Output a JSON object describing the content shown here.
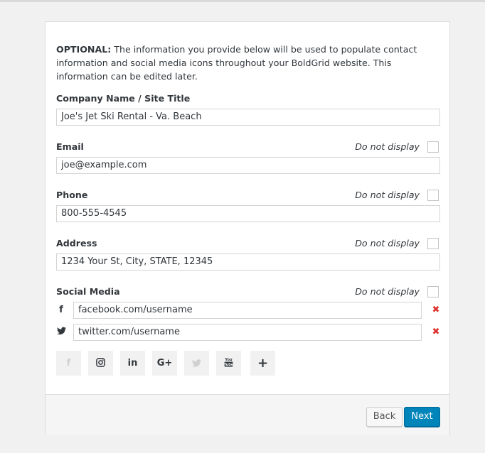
{
  "intro": {
    "prefix": "OPTIONAL:",
    "text": " The information you provide below will be used to populate contact information and social media icons throughout your BoldGrid website. This information can be edited later."
  },
  "company": {
    "label": "Company Name / Site Title",
    "value": "Joe's Jet Ski Rental - Va. Beach"
  },
  "email": {
    "label": "Email",
    "value": "joe@example.com",
    "no_display": "Do not display"
  },
  "phone": {
    "label": "Phone",
    "value": "800-555-4545",
    "no_display": "Do not display"
  },
  "address": {
    "label": "Address",
    "value": "1234 Your St, City, STATE, 12345",
    "no_display": "Do not display"
  },
  "social": {
    "label": "Social Media",
    "no_display": "Do not display",
    "rows": [
      {
        "icon": "facebook-icon",
        "glyph": "f",
        "value": "facebook.com/username"
      },
      {
        "icon": "twitter-icon",
        "glyph": "🐦",
        "value": "twitter.com/username"
      }
    ],
    "delete_glyph": "✖",
    "add_icons": [
      {
        "name": "facebook-icon",
        "glyph": "f",
        "state": "disabled"
      },
      {
        "name": "instagram-icon",
        "glyph": "◎",
        "state": "enabled"
      },
      {
        "name": "linkedin-icon",
        "glyph": "in",
        "state": "enabled"
      },
      {
        "name": "google-plus-icon",
        "glyph": "G+",
        "state": "enabled"
      },
      {
        "name": "twitter-icon",
        "glyph": "🐦",
        "state": "disabled"
      },
      {
        "name": "youtube-icon",
        "glyph": "You Tube",
        "state": "enabled"
      },
      {
        "name": "plus-icon",
        "glyph": "+",
        "state": "enabled"
      }
    ]
  },
  "buttons": {
    "back": "Back",
    "next": "Next"
  },
  "colors": {
    "primary": "#0085ba",
    "delete": "#dc3232"
  }
}
